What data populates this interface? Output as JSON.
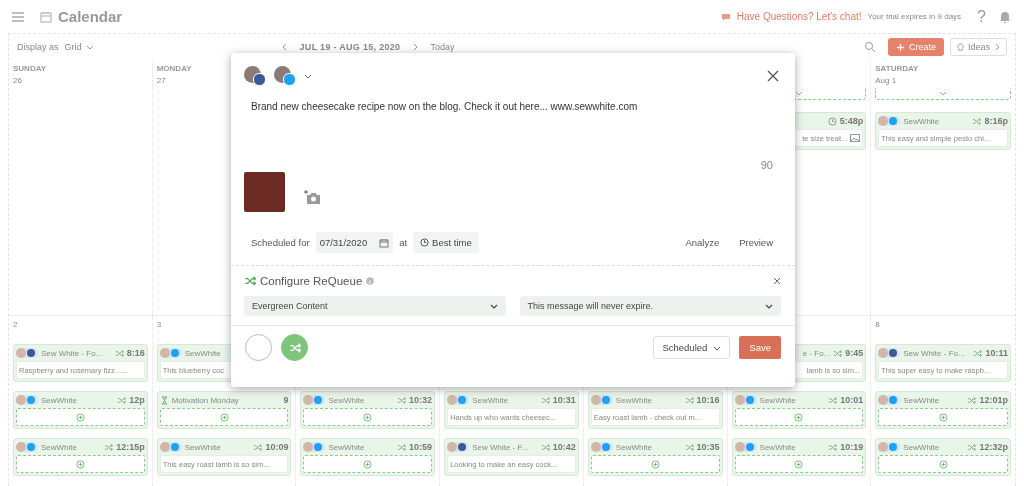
{
  "header": {
    "title": "Calendar",
    "chat_link": "Have Questions? Let's chat!",
    "trial_note": "Your trial expires in 9 days",
    "help": "?"
  },
  "toolbar": {
    "display_label": "Display as",
    "display_value": "Grid",
    "range": "JUL 19 - AUG 15, 2020",
    "today": "Today",
    "create": "Create",
    "ideas": "Ideas"
  },
  "weeks": [
    {
      "days": [
        {
          "weekday": "SUNDAY",
          "date": "26"
        },
        {
          "weekday": "MONDAY",
          "date": "27"
        },
        {
          "cards": [
            {
              "kind": "stub"
            },
            {
              "kind": "post",
              "cut": true,
              "timing": {
                "kind": "clock",
                "time": "5:48p"
              },
              "text": "te size treat...",
              "image": true
            }
          ]
        },
        {
          "weekday": "SATURDAY",
          "date": "Aug 1",
          "cards": [
            {
              "kind": "stub"
            },
            {
              "kind": "post",
              "cut": false,
              "badge": {
                "kind": "avatar",
                "color": "#1da1f2"
              },
              "account": "SewWhite",
              "timing": {
                "kind": "requeue",
                "time": "8:16p"
              },
              "text": "This easy and simple pesto chi..."
            }
          ]
        }
      ]
    },
    {
      "days": [
        {
          "date": "2",
          "cards": [
            {
              "kind": "post",
              "cut": false,
              "badge": {
                "kind": "avatar",
                "color": "#3b5998"
              },
              "account": "Sew White - Fo...",
              "timing": {
                "kind": "requeue",
                "time": "8:16"
              },
              "text": "Raspberry and rosemary fizz......"
            },
            {
              "kind": "empty",
              "cut": false,
              "badge": {
                "kind": "avatar",
                "color": "#1da1f2"
              },
              "account": "SewWhite",
              "timing": {
                "kind": "requeue",
                "time": "12p"
              }
            },
            {
              "kind": "empty",
              "cut": false,
              "badge": {
                "kind": "avatar",
                "color": "#1da1f2"
              },
              "account": "SewWhite",
              "timing": {
                "kind": "requeue",
                "time": "12:15p"
              }
            }
          ]
        },
        {
          "date": "3",
          "cards": [
            {
              "kind": "post",
              "cut": false,
              "badge": {
                "kind": "avatar",
                "color": "#1da1f2"
              },
              "account": "SewWhite",
              "text": "This blueberry coc"
            },
            {
              "kind": "empty",
              "cut": false,
              "badge": {
                "kind": "hourglass"
              },
              "account": "Motivation Monday",
              "timing": {
                "kind": "plain",
                "time": "9"
              }
            },
            {
              "kind": "post",
              "cut": false,
              "badge": {
                "kind": "avatar",
                "color": "#1da1f2"
              },
              "account": "SewWhite",
              "timing": {
                "kind": "requeue",
                "time": "10:09"
              },
              "text": "This easy roast lamb is so sim..."
            }
          ]
        },
        {
          "cards": [
            {
              "kind": "empty",
              "cut": false,
              "badge": {
                "kind": "avatar",
                "color": "#1da1f2"
              },
              "account": "SewWhite",
              "timing": {
                "kind": "requeue",
                "time": "10:32"
              }
            },
            {
              "kind": "empty",
              "cut": false,
              "badge": {
                "kind": "avatar",
                "color": "#1da1f2"
              },
              "account": "SewWhite",
              "timing": {
                "kind": "requeue",
                "time": "10:59"
              }
            }
          ]
        },
        {
          "cards": [
            {
              "kind": "post",
              "cut": false,
              "badge": {
                "kind": "avatar",
                "color": "#1da1f2"
              },
              "account": "SewWhite",
              "timing": {
                "kind": "requeue",
                "time": "10:31"
              },
              "text": "Hands up who wants cheesec..."
            },
            {
              "kind": "post",
              "cut": false,
              "badge": {
                "kind": "avatar",
                "color": "#3b5998"
              },
              "account": "Sew White - F...",
              "timing": {
                "kind": "requeue",
                "time": "10:42"
              },
              "text": "Looking to make an easy cock..."
            }
          ]
        },
        {
          "cards": [
            {
              "kind": "post",
              "cut": false,
              "badge": {
                "kind": "avatar",
                "color": "#1da1f2"
              },
              "account": "SewWhite",
              "timing": {
                "kind": "requeue",
                "time": "10:16"
              },
              "text": "Easy roast lamb - check out m..."
            },
            {
              "kind": "empty",
              "cut": false,
              "badge": {
                "kind": "avatar",
                "color": "#1da1f2"
              },
              "account": "SewWhite",
              "timing": {
                "kind": "requeue",
                "time": "10:35"
              }
            }
          ]
        },
        {
          "cards": [
            {
              "kind": "post",
              "cut": true,
              "account": "e - Fo...",
              "timing": {
                "kind": "requeue",
                "time": "9:45"
              },
              "text": "lamb is so sim..."
            },
            {
              "kind": "empty",
              "cut": false,
              "badge": {
                "kind": "avatar",
                "color": "#1da1f2"
              },
              "account": "SewWhite",
              "timing": {
                "kind": "requeue",
                "time": "10:01"
              }
            },
            {
              "kind": "empty",
              "cut": false,
              "badge": {
                "kind": "avatar",
                "color": "#1da1f2"
              },
              "account": "SewWhite",
              "timing": {
                "kind": "requeue",
                "time": "10:19"
              }
            }
          ]
        },
        {
          "date": "8",
          "cards": [
            {
              "kind": "post",
              "cut": false,
              "badge": {
                "kind": "avatar",
                "color": "#3b5998"
              },
              "account": "Sew White - Fo...",
              "timing": {
                "kind": "requeue",
                "time": "10:11"
              },
              "text": "This super easy to make raspb..."
            },
            {
              "kind": "empty",
              "cut": false,
              "badge": {
                "kind": "avatar",
                "color": "#1da1f2"
              },
              "account": "SewWhite",
              "timing": {
                "kind": "requeue",
                "time": "12:01p"
              }
            },
            {
              "kind": "empty",
              "cut": false,
              "badge": {
                "kind": "avatar",
                "color": "#1da1f2"
              },
              "account": "SewWhite",
              "timing": {
                "kind": "requeue",
                "time": "12:32p"
              }
            }
          ]
        }
      ]
    }
  ],
  "composer": {
    "accounts": [
      {
        "color": "#3b5998"
      },
      {
        "color": "#1da1f2"
      }
    ],
    "message": "Brand new cheesecake recipe now on the blog. Check it out here... www.sewwhite.com",
    "counter": "90",
    "schedule_label": "Scheduled for",
    "date": "07/31/2020",
    "at": "at",
    "best_time": "Best time",
    "actions": [
      "Analyze",
      "Preview"
    ],
    "requeue": {
      "title": "Configure ReQueue",
      "category": "Evergreen Content",
      "expiry": "This message will never expire."
    },
    "modes": [
      {
        "kind": "blank",
        "selected": false
      },
      {
        "kind": "requeue",
        "selected": true
      }
    ],
    "status": "Scheduled",
    "save": "Save"
  }
}
